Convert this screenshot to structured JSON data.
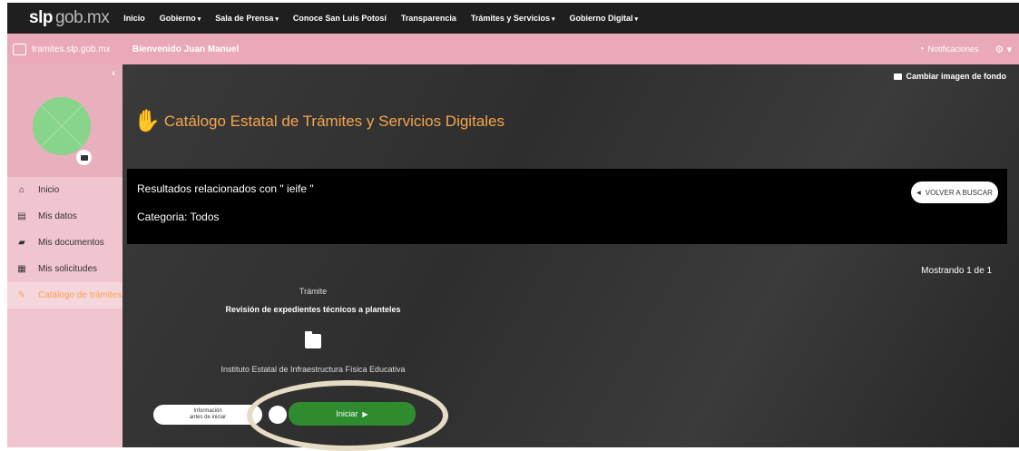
{
  "topnav": {
    "brand_slp": "slp",
    "brand_gob": "gob.mx",
    "items": [
      {
        "label": "Inicio",
        "caret": ""
      },
      {
        "label": "Gobierno",
        "caret": "▾"
      },
      {
        "label": "Sala de Prensa",
        "caret": "▾"
      },
      {
        "label": "Conoce San Luis Potosí",
        "caret": ""
      },
      {
        "label": "Transparencia",
        "caret": ""
      },
      {
        "label": "Trámites y Servicios",
        "caret": "▾"
      },
      {
        "label": "Gobierno Digital",
        "caret": "▾"
      }
    ]
  },
  "pinkbar": {
    "site": "tramites.slp.gob.mx",
    "welcome": "Bienvenido Juan Manuel",
    "notifications": "Notificaciones",
    "gear_caret": "⚙ ▾"
  },
  "sidebar": {
    "collapse": "‹",
    "items": [
      {
        "label": "Inicio",
        "icon": "⌂",
        "icon_name": "home-icon"
      },
      {
        "label": "Mis datos",
        "icon": "▤",
        "icon_name": "id-card-icon"
      },
      {
        "label": "Mis documentos",
        "icon": "▰",
        "icon_name": "folder-icon"
      },
      {
        "label": "Mis solicitudes",
        "icon": "▦",
        "icon_name": "list-icon"
      },
      {
        "label": "Catálogo de trámites",
        "icon": "✎",
        "icon_name": "catalog-icon"
      }
    ]
  },
  "main": {
    "change_background": "Cambiar imagen de fondo",
    "title": "Catálogo Estatal de Trámites y Servicios Digitales",
    "results_text": "Resultados relacionados con \" ieife \"",
    "category_text": "Categoria: Todos",
    "back_button": "VOLVER A BUSCAR",
    "showing": "Mostrando 1 de 1",
    "card": {
      "type": "Trámite",
      "name": "Revisión de expedientes técnicos a planteles",
      "institution": "Instituto Estatal de Infraestructura Física Educativa",
      "info_button_line1": "Información",
      "info_button_line2": "antes de iniciar",
      "start_button": "Iniciar"
    }
  },
  "colors": {
    "accent": "#f6a54c",
    "pink": "#e9a9b8",
    "start_green": "#2e8b2e",
    "highlight_ellipse": "#e6dcc6"
  }
}
